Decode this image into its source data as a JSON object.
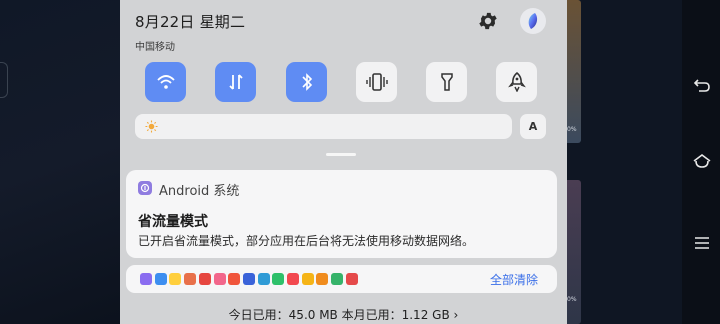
{
  "background_app": {
    "percent_labels": [
      "0%",
      "0%"
    ]
  },
  "status": {
    "date": "8月22日 星期二",
    "carrier": "中国移动"
  },
  "quick_settings": {
    "tiles": [
      {
        "name": "wifi",
        "icon": "wifi-icon",
        "active": true
      },
      {
        "name": "mobile-data",
        "icon": "data-arrows-icon",
        "active": true
      },
      {
        "name": "bluetooth",
        "icon": "bluetooth-icon",
        "active": true
      },
      {
        "name": "vibrate",
        "icon": "vibrate-icon",
        "active": false
      },
      {
        "name": "flashlight",
        "icon": "flashlight-icon",
        "active": false
      },
      {
        "name": "rocket",
        "icon": "rocket-icon",
        "active": false
      }
    ],
    "accent_color": "#5f8cf3",
    "auto_brightness_label": "A"
  },
  "notification": {
    "app_name": "Android 系统",
    "title": "省流量模式",
    "body": "已开启省流量模式，部分应用在后台将无法使用移动数据网络。"
  },
  "notification_icons": {
    "clear_all_label": "全部清除",
    "app_icon_colors": [
      "#8a6cf0",
      "#3d8ef0",
      "#ffcf3d",
      "#e8704a",
      "#e6463f",
      "#f2668b",
      "#f0553c",
      "#3a63d9",
      "#2f9bd6",
      "#2ec06a",
      "#f2484f",
      "#f5b417",
      "#f08c1e",
      "#36b36a",
      "#e54a4a"
    ]
  },
  "usage": {
    "text": "今日已用：45.0 MB 本月已用：1.12 GB",
    "chevron": "›"
  },
  "nav": {
    "buttons": [
      "back-icon",
      "home-icon",
      "menu-icon"
    ]
  }
}
